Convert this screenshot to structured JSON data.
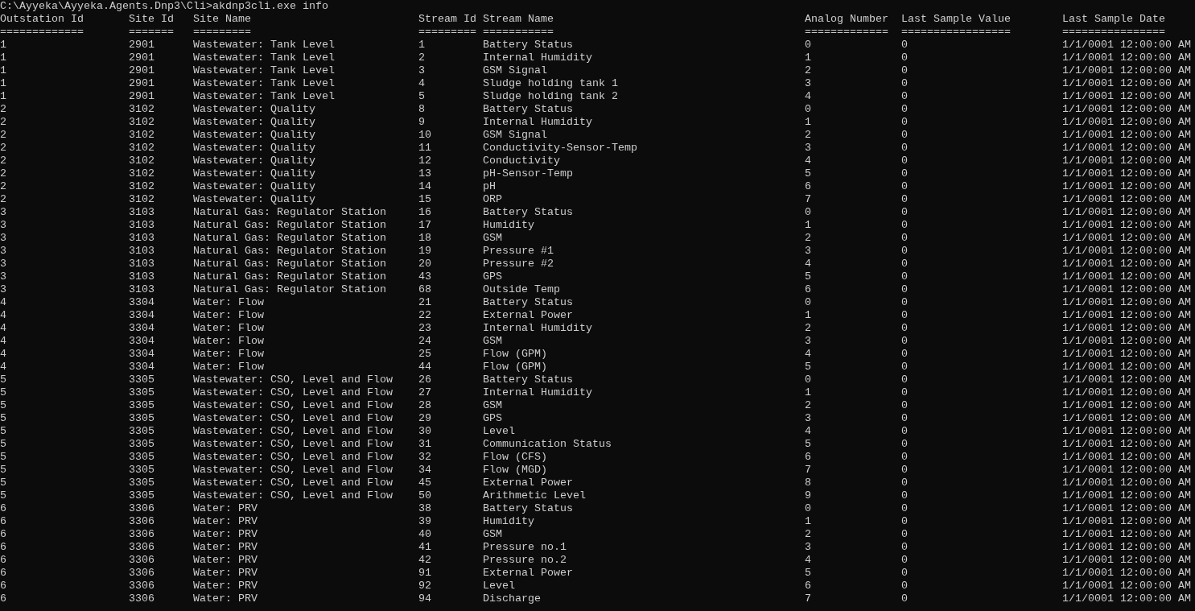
{
  "prompt": "C:\\Ayyeka\\Ayyeka.Agents.Dnp3\\Cli>akdnp3cli.exe info",
  "columns": [
    {
      "heading": "Outstation Id",
      "underline": "============="
    },
    {
      "heading": "Site Id",
      "underline": "======="
    },
    {
      "heading": "Site Name",
      "underline": "========="
    },
    {
      "heading": "Stream Id",
      "underline": "========="
    },
    {
      "heading": "Stream Name",
      "underline": "==========="
    },
    {
      "heading": "Analog Number",
      "underline": "============="
    },
    {
      "heading": "Last Sample Value",
      "underline": "================="
    },
    {
      "heading": "Last Sample Date",
      "underline": "================"
    }
  ],
  "rows": [
    [
      "1",
      "2901",
      "Wastewater: Tank Level",
      "1",
      "Battery Status",
      "0",
      "0",
      "1/1/0001 12:00:00 AM"
    ],
    [
      "1",
      "2901",
      "Wastewater: Tank Level",
      "2",
      "Internal Humidity",
      "1",
      "0",
      "1/1/0001 12:00:00 AM"
    ],
    [
      "1",
      "2901",
      "Wastewater: Tank Level",
      "3",
      "GSM Signal",
      "2",
      "0",
      "1/1/0001 12:00:00 AM"
    ],
    [
      "1",
      "2901",
      "Wastewater: Tank Level",
      "4",
      "Sludge holding tank 1",
      "3",
      "0",
      "1/1/0001 12:00:00 AM"
    ],
    [
      "1",
      "2901",
      "Wastewater: Tank Level",
      "5",
      "Sludge holding tank 2",
      "4",
      "0",
      "1/1/0001 12:00:00 AM"
    ],
    [
      "2",
      "3102",
      "Wastewater: Quality",
      "8",
      "Battery Status",
      "0",
      "0",
      "1/1/0001 12:00:00 AM"
    ],
    [
      "2",
      "3102",
      "Wastewater: Quality",
      "9",
      "Internal Humidity",
      "1",
      "0",
      "1/1/0001 12:00:00 AM"
    ],
    [
      "2",
      "3102",
      "Wastewater: Quality",
      "10",
      "GSM Signal",
      "2",
      "0",
      "1/1/0001 12:00:00 AM"
    ],
    [
      "2",
      "3102",
      "Wastewater: Quality",
      "11",
      "Conductivity-Sensor-Temp",
      "3",
      "0",
      "1/1/0001 12:00:00 AM"
    ],
    [
      "2",
      "3102",
      "Wastewater: Quality",
      "12",
      "Conductivity",
      "4",
      "0",
      "1/1/0001 12:00:00 AM"
    ],
    [
      "2",
      "3102",
      "Wastewater: Quality",
      "13",
      "pH-Sensor-Temp",
      "5",
      "0",
      "1/1/0001 12:00:00 AM"
    ],
    [
      "2",
      "3102",
      "Wastewater: Quality",
      "14",
      "pH",
      "6",
      "0",
      "1/1/0001 12:00:00 AM"
    ],
    [
      "2",
      "3102",
      "Wastewater: Quality",
      "15",
      "ORP",
      "7",
      "0",
      "1/1/0001 12:00:00 AM"
    ],
    [
      "3",
      "3103",
      "Natural Gas: Regulator Station",
      "16",
      "Battery Status",
      "0",
      "0",
      "1/1/0001 12:00:00 AM"
    ],
    [
      "3",
      "3103",
      "Natural Gas: Regulator Station",
      "17",
      "Humidity",
      "1",
      "0",
      "1/1/0001 12:00:00 AM"
    ],
    [
      "3",
      "3103",
      "Natural Gas: Regulator Station",
      "18",
      "GSM",
      "2",
      "0",
      "1/1/0001 12:00:00 AM"
    ],
    [
      "3",
      "3103",
      "Natural Gas: Regulator Station",
      "19",
      "Pressure #1",
      "3",
      "0",
      "1/1/0001 12:00:00 AM"
    ],
    [
      "3",
      "3103",
      "Natural Gas: Regulator Station",
      "20",
      "Pressure #2",
      "4",
      "0",
      "1/1/0001 12:00:00 AM"
    ],
    [
      "3",
      "3103",
      "Natural Gas: Regulator Station",
      "43",
      "GPS",
      "5",
      "0",
      "1/1/0001 12:00:00 AM"
    ],
    [
      "3",
      "3103",
      "Natural Gas: Regulator Station",
      "68",
      "Outside Temp",
      "6",
      "0",
      "1/1/0001 12:00:00 AM"
    ],
    [
      "4",
      "3304",
      "Water: Flow",
      "21",
      "Battery Status",
      "0",
      "0",
      "1/1/0001 12:00:00 AM"
    ],
    [
      "4",
      "3304",
      "Water: Flow",
      "22",
      "External Power",
      "1",
      "0",
      "1/1/0001 12:00:00 AM"
    ],
    [
      "4",
      "3304",
      "Water: Flow",
      "23",
      "Internal Humidity",
      "2",
      "0",
      "1/1/0001 12:00:00 AM"
    ],
    [
      "4",
      "3304",
      "Water: Flow",
      "24",
      "GSM",
      "3",
      "0",
      "1/1/0001 12:00:00 AM"
    ],
    [
      "4",
      "3304",
      "Water: Flow",
      "25",
      "Flow (GPM)",
      "4",
      "0",
      "1/1/0001 12:00:00 AM"
    ],
    [
      "4",
      "3304",
      "Water: Flow",
      "44",
      "Flow (GPM)",
      "5",
      "0",
      "1/1/0001 12:00:00 AM"
    ],
    [
      "5",
      "3305",
      "Wastewater: CSO, Level and Flow",
      "26",
      "Battery Status",
      "0",
      "0",
      "1/1/0001 12:00:00 AM"
    ],
    [
      "5",
      "3305",
      "Wastewater: CSO, Level and Flow",
      "27",
      "Internal Humidity",
      "1",
      "0",
      "1/1/0001 12:00:00 AM"
    ],
    [
      "5",
      "3305",
      "Wastewater: CSO, Level and Flow",
      "28",
      "GSM",
      "2",
      "0",
      "1/1/0001 12:00:00 AM"
    ],
    [
      "5",
      "3305",
      "Wastewater: CSO, Level and Flow",
      "29",
      "GPS",
      "3",
      "0",
      "1/1/0001 12:00:00 AM"
    ],
    [
      "5",
      "3305",
      "Wastewater: CSO, Level and Flow",
      "30",
      "Level",
      "4",
      "0",
      "1/1/0001 12:00:00 AM"
    ],
    [
      "5",
      "3305",
      "Wastewater: CSO, Level and Flow",
      "31",
      "Communication Status",
      "5",
      "0",
      "1/1/0001 12:00:00 AM"
    ],
    [
      "5",
      "3305",
      "Wastewater: CSO, Level and Flow",
      "32",
      "Flow (CFS)",
      "6",
      "0",
      "1/1/0001 12:00:00 AM"
    ],
    [
      "5",
      "3305",
      "Wastewater: CSO, Level and Flow",
      "34",
      "Flow (MGD)",
      "7",
      "0",
      "1/1/0001 12:00:00 AM"
    ],
    [
      "5",
      "3305",
      "Wastewater: CSO, Level and Flow",
      "45",
      "External Power",
      "8",
      "0",
      "1/1/0001 12:00:00 AM"
    ],
    [
      "5",
      "3305",
      "Wastewater: CSO, Level and Flow",
      "50",
      "Arithmetic Level",
      "9",
      "0",
      "1/1/0001 12:00:00 AM"
    ],
    [
      "6",
      "3306",
      "Water: PRV",
      "38",
      "Battery Status",
      "0",
      "0",
      "1/1/0001 12:00:00 AM"
    ],
    [
      "6",
      "3306",
      "Water: PRV",
      "39",
      "Humidity",
      "1",
      "0",
      "1/1/0001 12:00:00 AM"
    ],
    [
      "6",
      "3306",
      "Water: PRV",
      "40",
      "GSM",
      "2",
      "0",
      "1/1/0001 12:00:00 AM"
    ],
    [
      "6",
      "3306",
      "Water: PRV",
      "41",
      "Pressure no.1",
      "3",
      "0",
      "1/1/0001 12:00:00 AM"
    ],
    [
      "6",
      "3306",
      "Water: PRV",
      "42",
      "Pressure no.2",
      "4",
      "0",
      "1/1/0001 12:00:00 AM"
    ],
    [
      "6",
      "3306",
      "Water: PRV",
      "91",
      "External Power",
      "5",
      "0",
      "1/1/0001 12:00:00 AM"
    ],
    [
      "6",
      "3306",
      "Water: PRV",
      "92",
      "Level",
      "6",
      "0",
      "1/1/0001 12:00:00 AM"
    ],
    [
      "6",
      "3306",
      "Water: PRV",
      "94",
      "Discharge",
      "7",
      "0",
      "1/1/0001 12:00:00 AM"
    ]
  ]
}
